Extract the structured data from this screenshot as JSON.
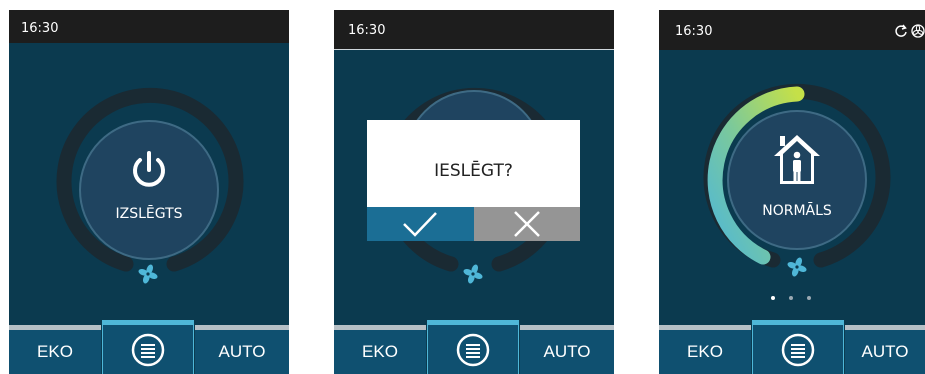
{
  "screens": [
    {
      "time": "16:30",
      "center_label": "IZSLĒGTS",
      "center_icon": "power-icon",
      "fan_icon": "fan-icon",
      "bottom": {
        "left_label": "EKO",
        "menu_icon": "menu-icon",
        "right_label": "AUTO"
      }
    },
    {
      "time": "16:30",
      "dialog": {
        "question": "IESLĒGT?",
        "confirm_icon": "check-icon",
        "cancel_icon": "close-icon"
      },
      "fan_icon": "fan-icon",
      "bottom": {
        "left_label": "EKO",
        "menu_icon": "menu-icon",
        "right_label": "AUTO"
      }
    },
    {
      "time": "16:30",
      "status_icons": [
        "sync-icon",
        "fan-status-icon"
      ],
      "center_label": "NORMĀLS",
      "center_icon": "home-person-icon",
      "fan_icon": "fan-icon",
      "page_dots": 3,
      "active_dot": 0,
      "bottom": {
        "left_label": "EKO",
        "menu_icon": "menu-icon",
        "right_label": "AUTO"
      }
    }
  ],
  "colors": {
    "screen_bg": "#0b3a4f",
    "statusbar_bg": "#1d1d1d",
    "button_bg": "#0f5070",
    "ring_track": "#1a2a33",
    "gradient_start": "#c5e048",
    "gradient_end": "#4fb7d8",
    "dialog_ok": "#1b6e95",
    "dialog_cancel": "#959595"
  }
}
